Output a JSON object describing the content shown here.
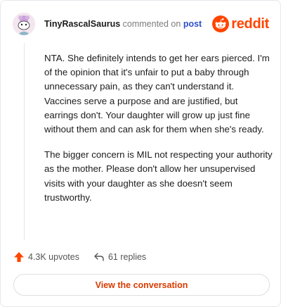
{
  "header": {
    "username": "TinyRascalSaurus",
    "action_text": "commented on",
    "post_link": "post",
    "brand": "reddit",
    "avatar_icon": "snoo-avatar-icon",
    "brand_icon": "reddit-alien-icon"
  },
  "comment": {
    "paragraphs": [
      "NTA. She definitely intends to get her ears pierced. I'm of the opinion that it's unfair to put a baby through unnecessary pain, as they can't understand it. Vaccines serve a purpose and are justified, but earrings don't. Your daughter will grow up just fine without them and can ask for them when she's ready.",
      "The bigger concern is MIL not respecting your authority as the mother. Please don't allow her unsupervised visits with your daughter as she doesn't seem trustworthy."
    ]
  },
  "actions": {
    "upvotes": "4.3K upvotes",
    "replies": "61 replies",
    "upvote_icon": "upvote-arrow-icon",
    "reply_icon": "reply-arrow-icon"
  },
  "cta": {
    "label": "View the conversation"
  },
  "colors": {
    "brand": "#ff4500",
    "link": "#2f4fc9",
    "cta_text": "#d93a00"
  }
}
